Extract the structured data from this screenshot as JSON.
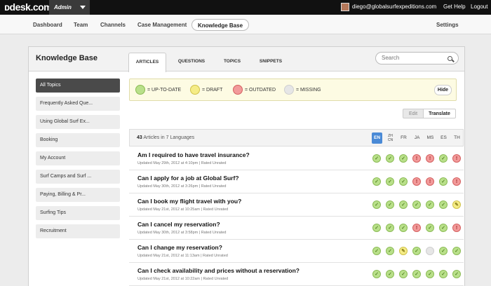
{
  "topbar": {
    "logo": "ᴅdesk.com",
    "admin_label": "Admin",
    "user_email": "diego@globalsurfexpeditions.com",
    "help": "Get Help",
    "logout": "Logout"
  },
  "nav": {
    "items": [
      "Dashboard",
      "Team",
      "Channels",
      "Case Management",
      "Knowledge Base"
    ],
    "active": "Knowledge Base",
    "settings": "Settings"
  },
  "panel": {
    "title": "Knowledge Base",
    "tabs": [
      "ARTICLES",
      "QUESTIONS",
      "TOPICS",
      "SNIPPETS"
    ],
    "active_tab": "ARTICLES",
    "search_placeholder": "Search"
  },
  "sidebar": {
    "items": [
      "All Topics",
      "Frequently Asked Que...",
      "Using Global Surf Ex...",
      "Booking",
      "My Account",
      "Surf Camps and Surf ...",
      "Paying, Billing & Pr...",
      "Surfing Tips",
      "Recruitment"
    ],
    "active": "All Topics"
  },
  "legend": {
    "up_to_date": "= UP-TO-DATE",
    "draft": "= DRAFT",
    "outdated": "= OUTDATED",
    "missing": "= MISSING",
    "hide": "Hide",
    "colors": {
      "ok": "#b9e08a",
      "draft": "#f5ec86",
      "outdated": "#f29a9a",
      "missing": "#e6e6e6"
    }
  },
  "mode": {
    "edit": "Edit",
    "translate": "Translate"
  },
  "articles": {
    "count": "43",
    "count_suffix": "Articles in 7 Languages",
    "languages": [
      "EN",
      "ZH CN",
      "FR",
      "JA",
      "MS",
      "ES",
      "TH"
    ],
    "active_language": "EN",
    "rows": [
      {
        "title": "Am I required to have travel insurance?",
        "meta": "Updated May 29th, 2012 at 4:10pm  |  Rated Unrated",
        "status": [
          "ok",
          "ok",
          "ok",
          "out",
          "out",
          "ok",
          "out"
        ]
      },
      {
        "title": "Can I apply for a job at Global Surf?",
        "meta": "Updated May 30th, 2012 at 3:26pm  |  Rated Unrated",
        "status": [
          "ok",
          "ok",
          "ok",
          "out",
          "out",
          "ok",
          "out"
        ]
      },
      {
        "title": "Can I book my flight travel with you?",
        "meta": "Updated May 21st, 2012 at 10:25am  |  Rated Unrated",
        "status": [
          "ok",
          "ok",
          "ok",
          "ok",
          "ok",
          "ok",
          "draft"
        ]
      },
      {
        "title": "Can I cancel my reservation?",
        "meta": "Updated May 30th, 2012 at 3:58pm  |  Rated Unrated",
        "status": [
          "ok",
          "ok",
          "ok",
          "out",
          "ok",
          "ok",
          "out"
        ]
      },
      {
        "title": "Can I change my reservation?",
        "meta": "Updated May 21st, 2012 at 11:13am  |  Rated Unrated",
        "status": [
          "ok",
          "ok",
          "draft",
          "ok",
          "miss",
          "ok",
          "ok"
        ]
      },
      {
        "title": "Can I check availability and prices without a reservation?",
        "meta": "Updated May 21st, 2012 at 10:22am  |  Rated Unrated",
        "status": [
          "ok",
          "ok",
          "ok",
          "ok",
          "ok",
          "ok",
          "ok"
        ]
      }
    ]
  }
}
